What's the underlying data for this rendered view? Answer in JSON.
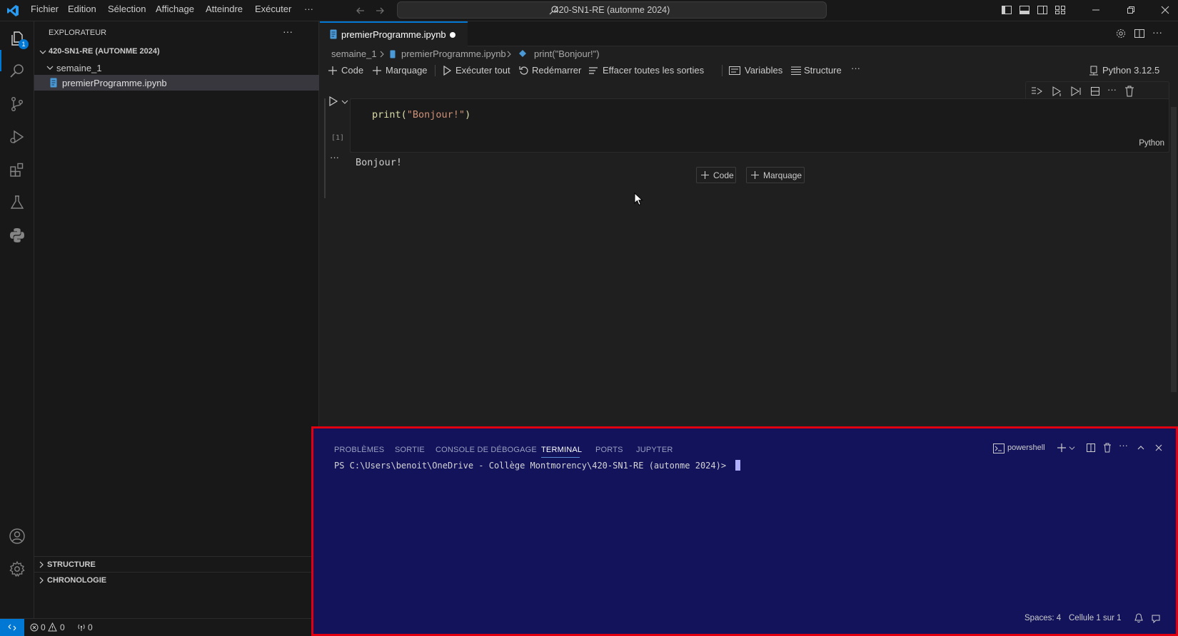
{
  "titlebar": {
    "menu": [
      "Fichier",
      "Edition",
      "Sélection",
      "Affichage",
      "Atteindre",
      "Exécuter",
      "···"
    ],
    "command_center": "420-SN1-RE (autonme 2024)"
  },
  "activitybar": {
    "explorer_badge": "1",
    "icons": [
      "files-icon",
      "search-icon",
      "source-control-icon",
      "run-debug-icon",
      "extensions-icon",
      "testing-icon",
      "python-icon",
      "account-icon",
      "settings-gear-icon"
    ]
  },
  "sidebar": {
    "title": "EXPLORATEUR",
    "more": "···",
    "root": "420-SN1-RE (AUTONME 2024)",
    "folder": "semaine_1",
    "file": "premierProgramme.ipynb",
    "sections": [
      "STRUCTURE",
      "CHRONOLOGIE"
    ]
  },
  "editor": {
    "tab_label": "premierProgramme.ipynb",
    "breadcrumb": {
      "folder": "semaine_1",
      "file": "premierProgramme.ipynb",
      "symbol": "print(\"Bonjour!\")"
    },
    "toolbar": {
      "code": "Code",
      "markdown": "Marquage",
      "run_all": "Exécuter tout",
      "restart": "Redémarrer",
      "clear_outputs": "Effacer toutes les sorties",
      "variables": "Variables",
      "outline": "Structure",
      "more": "···",
      "kernel": "Python 3.12.5"
    },
    "cell": {
      "code_fn": "print(",
      "code_str": "\"Bonjour!\"",
      "code_end": ")",
      "exec_count": "[1]",
      "language": "Python",
      "output_dots": "···",
      "output": "Bonjour!"
    },
    "add_cell": {
      "code": "Code",
      "markdown": "Marquage"
    }
  },
  "panel": {
    "tabs": [
      "PROBLÈMES",
      "SORTIE",
      "CONSOLE DE DÉBOGAGE",
      "TERMINAL",
      "PORTS",
      "JUPYTER"
    ],
    "active_tab": "TERMINAL",
    "shell": "powershell",
    "prompt": "PS C:\\Users\\benoit\\OneDrive - Collège Montmorency\\420-SN1-RE (autonme 2024)>"
  },
  "statusbar": {
    "errors": "0",
    "warnings": "0",
    "ports": "0",
    "spaces": "Spaces: 4",
    "cell": "Cellule 1 sur 1"
  },
  "colors": {
    "accent": "#0078d4",
    "terminal_bg": "#13135c",
    "highlight_border": "#e00010",
    "string": "#ce9178",
    "function": "#dcdcaa"
  }
}
